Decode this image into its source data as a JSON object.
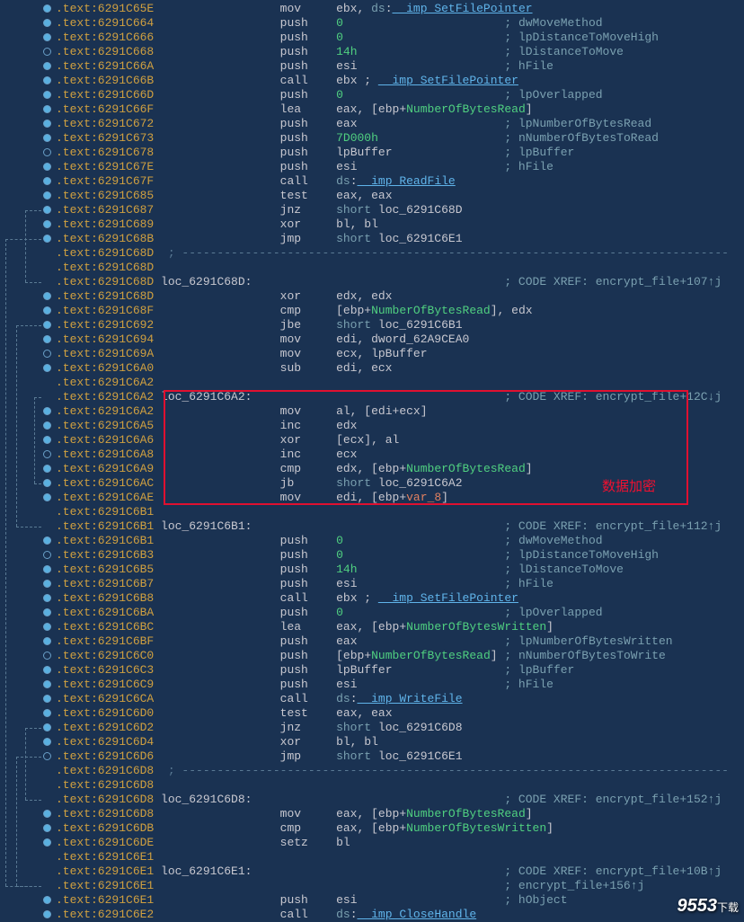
{
  "redbox_label": "数据加密",
  "watermark": {
    "brand": "9553",
    "suffix": "下载"
  },
  "lines": [
    {
      "addr": ".text:6291C65E",
      "mnem": "mov",
      "ops": [
        {
          "t": "reg",
          "v": "ebx, "
        },
        {
          "t": "kw",
          "v": "ds"
        },
        {
          "t": "op",
          "v": ":"
        },
        {
          "t": "imp",
          "v": "__imp_SetFilePointer"
        }
      ]
    },
    {
      "addr": ".text:6291C664",
      "mnem": "push",
      "ops": [
        {
          "t": "num",
          "v": "0"
        }
      ],
      "comment": "dwMoveMethod"
    },
    {
      "addr": ".text:6291C666",
      "mnem": "push",
      "ops": [
        {
          "t": "num",
          "v": "0"
        }
      ],
      "comment": "lpDistanceToMoveHigh"
    },
    {
      "addr": ".text:6291C668",
      "mnem": "push",
      "ops": [
        {
          "t": "num",
          "v": "14h"
        }
      ],
      "comment": "lDistanceToMove"
    },
    {
      "addr": ".text:6291C66A",
      "mnem": "push",
      "ops": [
        {
          "t": "reg",
          "v": "esi"
        }
      ],
      "comment": "hFile"
    },
    {
      "addr": ".text:6291C66B",
      "mnem": "call",
      "ops": [
        {
          "t": "reg",
          "v": "ebx ; "
        },
        {
          "t": "imp",
          "v": "__imp_SetFilePointer"
        }
      ]
    },
    {
      "addr": ".text:6291C66D",
      "mnem": "push",
      "ops": [
        {
          "t": "num",
          "v": "0"
        }
      ],
      "comment": "lpOverlapped"
    },
    {
      "addr": ".text:6291C66F",
      "mnem": "lea",
      "ops": [
        {
          "t": "reg",
          "v": "eax, "
        },
        {
          "t": "op",
          "v": "["
        },
        {
          "t": "reg",
          "v": "ebp"
        },
        {
          "t": "op",
          "v": "+"
        },
        {
          "t": "var",
          "v": "NumberOfBytesRead"
        },
        {
          "t": "op",
          "v": "]"
        }
      ]
    },
    {
      "addr": ".text:6291C672",
      "mnem": "push",
      "ops": [
        {
          "t": "reg",
          "v": "eax"
        }
      ],
      "comment": "lpNumberOfBytesRead"
    },
    {
      "addr": ".text:6291C673",
      "mnem": "push",
      "ops": [
        {
          "t": "num",
          "v": "7D000h"
        }
      ],
      "comment": "nNumberOfBytesToRead"
    },
    {
      "addr": ".text:6291C678",
      "mnem": "push",
      "ops": [
        {
          "t": "reg",
          "v": "lpBuffer"
        }
      ],
      "comment": "lpBuffer"
    },
    {
      "addr": ".text:6291C67E",
      "mnem": "push",
      "ops": [
        {
          "t": "reg",
          "v": "esi"
        }
      ],
      "comment": "hFile"
    },
    {
      "addr": ".text:6291C67F",
      "mnem": "call",
      "ops": [
        {
          "t": "kw",
          "v": "ds"
        },
        {
          "t": "op",
          "v": ":"
        },
        {
          "t": "imp",
          "v": "__imp_ReadFile"
        }
      ]
    },
    {
      "addr": ".text:6291C685",
      "mnem": "test",
      "ops": [
        {
          "t": "reg",
          "v": "eax, eax"
        }
      ]
    },
    {
      "addr": ".text:6291C687",
      "mnem": "jnz",
      "ops": [
        {
          "t": "kw",
          "v": "short "
        },
        {
          "t": "label",
          "v": "loc_6291C68D"
        }
      ]
    },
    {
      "addr": ".text:6291C689",
      "mnem": "xor",
      "ops": [
        {
          "t": "reg",
          "v": "bl, bl"
        }
      ]
    },
    {
      "addr": ".text:6291C68B",
      "mnem": "jmp",
      "ops": [
        {
          "t": "kw",
          "v": "short "
        },
        {
          "t": "label",
          "v": "loc_6291C6E1"
        }
      ]
    },
    {
      "addr": ".text:6291C68D",
      "sep": true
    },
    {
      "addr": ".text:6291C68D",
      "blank": true
    },
    {
      "addr": ".text:6291C68D",
      "labeldef": "loc_6291C68D:",
      "xref": "CODE XREF: encrypt_file+107↑j"
    },
    {
      "addr": ".text:6291C68D",
      "mnem": "xor",
      "ops": [
        {
          "t": "reg",
          "v": "edx, edx"
        }
      ]
    },
    {
      "addr": ".text:6291C68F",
      "mnem": "cmp",
      "ops": [
        {
          "t": "op",
          "v": "["
        },
        {
          "t": "reg",
          "v": "ebp"
        },
        {
          "t": "op",
          "v": "+"
        },
        {
          "t": "var",
          "v": "NumberOfBytesRead"
        },
        {
          "t": "op",
          "v": "], "
        },
        {
          "t": "reg",
          "v": "edx"
        }
      ]
    },
    {
      "addr": ".text:6291C692",
      "mnem": "jbe",
      "ops": [
        {
          "t": "kw",
          "v": "short "
        },
        {
          "t": "label",
          "v": "loc_6291C6B1"
        }
      ]
    },
    {
      "addr": ".text:6291C694",
      "mnem": "mov",
      "ops": [
        {
          "t": "reg",
          "v": "edi, "
        },
        {
          "t": "label",
          "v": "dword_62A9CEA0"
        }
      ]
    },
    {
      "addr": ".text:6291C69A",
      "mnem": "mov",
      "ops": [
        {
          "t": "reg",
          "v": "ecx, lpBuffer"
        }
      ]
    },
    {
      "addr": ".text:6291C6A0",
      "mnem": "sub",
      "ops": [
        {
          "t": "reg",
          "v": "edi, ecx"
        }
      ]
    },
    {
      "addr": ".text:6291C6A2",
      "blank": true
    },
    {
      "addr": ".text:6291C6A2",
      "labeldef": "loc_6291C6A2:",
      "xref": "CODE XREF: encrypt_file+12C↓j"
    },
    {
      "addr": ".text:6291C6A2",
      "mnem": "mov",
      "ops": [
        {
          "t": "reg",
          "v": "al, "
        },
        {
          "t": "op",
          "v": "["
        },
        {
          "t": "reg",
          "v": "edi"
        },
        {
          "t": "op",
          "v": "+"
        },
        {
          "t": "reg",
          "v": "ecx"
        },
        {
          "t": "op",
          "v": "]"
        }
      ]
    },
    {
      "addr": ".text:6291C6A5",
      "mnem": "inc",
      "ops": [
        {
          "t": "reg",
          "v": "edx"
        }
      ]
    },
    {
      "addr": ".text:6291C6A6",
      "mnem": "xor",
      "ops": [
        {
          "t": "op",
          "v": "["
        },
        {
          "t": "reg",
          "v": "ecx"
        },
        {
          "t": "op",
          "v": "], "
        },
        {
          "t": "reg",
          "v": "al"
        }
      ]
    },
    {
      "addr": ".text:6291C6A8",
      "mnem": "inc",
      "ops": [
        {
          "t": "reg",
          "v": "ecx"
        }
      ]
    },
    {
      "addr": ".text:6291C6A9",
      "mnem": "cmp",
      "ops": [
        {
          "t": "reg",
          "v": "edx, "
        },
        {
          "t": "op",
          "v": "["
        },
        {
          "t": "reg",
          "v": "ebp"
        },
        {
          "t": "op",
          "v": "+"
        },
        {
          "t": "var",
          "v": "NumberOfBytesRead"
        },
        {
          "t": "op",
          "v": "]"
        }
      ]
    },
    {
      "addr": ".text:6291C6AC",
      "mnem": "jb",
      "ops": [
        {
          "t": "kw",
          "v": "short "
        },
        {
          "t": "label",
          "v": "loc_6291C6A2"
        }
      ]
    },
    {
      "addr": ".text:6291C6AE",
      "mnem": "mov",
      "ops": [
        {
          "t": "reg",
          "v": "edi, "
        },
        {
          "t": "op",
          "v": "["
        },
        {
          "t": "reg",
          "v": "ebp"
        },
        {
          "t": "op",
          "v": "+"
        },
        {
          "t": "var2",
          "v": "var_8"
        },
        {
          "t": "op",
          "v": "]"
        }
      ]
    },
    {
      "addr": ".text:6291C6B1",
      "blank": true
    },
    {
      "addr": ".text:6291C6B1",
      "labeldef": "loc_6291C6B1:",
      "xref": "CODE XREF: encrypt_file+112↑j"
    },
    {
      "addr": ".text:6291C6B1",
      "mnem": "push",
      "ops": [
        {
          "t": "num",
          "v": "0"
        }
      ],
      "comment": "dwMoveMethod"
    },
    {
      "addr": ".text:6291C6B3",
      "mnem": "push",
      "ops": [
        {
          "t": "num",
          "v": "0"
        }
      ],
      "comment": "lpDistanceToMoveHigh"
    },
    {
      "addr": ".text:6291C6B5",
      "mnem": "push",
      "ops": [
        {
          "t": "num",
          "v": "14h"
        }
      ],
      "comment": "lDistanceToMove"
    },
    {
      "addr": ".text:6291C6B7",
      "mnem": "push",
      "ops": [
        {
          "t": "reg",
          "v": "esi"
        }
      ],
      "comment": "hFile"
    },
    {
      "addr": ".text:6291C6B8",
      "mnem": "call",
      "ops": [
        {
          "t": "reg",
          "v": "ebx ; "
        },
        {
          "t": "imp",
          "v": "__imp_SetFilePointer"
        }
      ]
    },
    {
      "addr": ".text:6291C6BA",
      "mnem": "push",
      "ops": [
        {
          "t": "num",
          "v": "0"
        }
      ],
      "comment": "lpOverlapped"
    },
    {
      "addr": ".text:6291C6BC",
      "mnem": "lea",
      "ops": [
        {
          "t": "reg",
          "v": "eax, "
        },
        {
          "t": "op",
          "v": "["
        },
        {
          "t": "reg",
          "v": "ebp"
        },
        {
          "t": "op",
          "v": "+"
        },
        {
          "t": "var",
          "v": "NumberOfBytesWritten"
        },
        {
          "t": "op",
          "v": "]"
        }
      ]
    },
    {
      "addr": ".text:6291C6BF",
      "mnem": "push",
      "ops": [
        {
          "t": "reg",
          "v": "eax"
        }
      ],
      "comment": "lpNumberOfBytesWritten"
    },
    {
      "addr": ".text:6291C6C0",
      "mnem": "push",
      "ops": [
        {
          "t": "op",
          "v": "["
        },
        {
          "t": "reg",
          "v": "ebp"
        },
        {
          "t": "op",
          "v": "+"
        },
        {
          "t": "var",
          "v": "NumberOfBytesRead"
        },
        {
          "t": "op",
          "v": "]"
        }
      ],
      "comment": "nNumberOfBytesToWrite"
    },
    {
      "addr": ".text:6291C6C3",
      "mnem": "push",
      "ops": [
        {
          "t": "reg",
          "v": "lpBuffer"
        }
      ],
      "comment": "lpBuffer"
    },
    {
      "addr": ".text:6291C6C9",
      "mnem": "push",
      "ops": [
        {
          "t": "reg",
          "v": "esi"
        }
      ],
      "comment": "hFile"
    },
    {
      "addr": ".text:6291C6CA",
      "mnem": "call",
      "ops": [
        {
          "t": "kw",
          "v": "ds"
        },
        {
          "t": "op",
          "v": ":"
        },
        {
          "t": "imp",
          "v": "__imp_WriteFile"
        }
      ]
    },
    {
      "addr": ".text:6291C6D0",
      "mnem": "test",
      "ops": [
        {
          "t": "reg",
          "v": "eax, eax"
        }
      ]
    },
    {
      "addr": ".text:6291C6D2",
      "mnem": "jnz",
      "ops": [
        {
          "t": "kw",
          "v": "short "
        },
        {
          "t": "label",
          "v": "loc_6291C6D8"
        }
      ]
    },
    {
      "addr": ".text:6291C6D4",
      "mnem": "xor",
      "ops": [
        {
          "t": "reg",
          "v": "bl, bl"
        }
      ]
    },
    {
      "addr": ".text:6291C6D6",
      "mnem": "jmp",
      "ops": [
        {
          "t": "kw",
          "v": "short "
        },
        {
          "t": "label",
          "v": "loc_6291C6E1"
        }
      ]
    },
    {
      "addr": ".text:6291C6D8",
      "sep": true
    },
    {
      "addr": ".text:6291C6D8",
      "blank": true
    },
    {
      "addr": ".text:6291C6D8",
      "labeldef": "loc_6291C6D8:",
      "xref": "CODE XREF: encrypt_file+152↑j"
    },
    {
      "addr": ".text:6291C6D8",
      "mnem": "mov",
      "ops": [
        {
          "t": "reg",
          "v": "eax, "
        },
        {
          "t": "op",
          "v": "["
        },
        {
          "t": "reg",
          "v": "ebp"
        },
        {
          "t": "op",
          "v": "+"
        },
        {
          "t": "var",
          "v": "NumberOfBytesRead"
        },
        {
          "t": "op",
          "v": "]"
        }
      ]
    },
    {
      "addr": ".text:6291C6DB",
      "mnem": "cmp",
      "ops": [
        {
          "t": "reg",
          "v": "eax, "
        },
        {
          "t": "op",
          "v": "["
        },
        {
          "t": "reg",
          "v": "ebp"
        },
        {
          "t": "op",
          "v": "+"
        },
        {
          "t": "var",
          "v": "NumberOfBytesWritten"
        },
        {
          "t": "op",
          "v": "]"
        }
      ]
    },
    {
      "addr": ".text:6291C6DE",
      "mnem": "setz",
      "ops": [
        {
          "t": "reg",
          "v": "bl"
        }
      ]
    },
    {
      "addr": ".text:6291C6E1",
      "blank": true
    },
    {
      "addr": ".text:6291C6E1",
      "labeldef": "loc_6291C6E1:",
      "xref": "CODE XREF: encrypt_file+10B↑j"
    },
    {
      "addr": ".text:6291C6E1",
      "xref2": "encrypt_file+156↑j"
    },
    {
      "addr": ".text:6291C6E1",
      "mnem": "push",
      "ops": [
        {
          "t": "reg",
          "v": "esi"
        }
      ],
      "comment": "hObject"
    },
    {
      "addr": ".text:6291C6E2",
      "mnem": "call",
      "ops": [
        {
          "t": "kw",
          "v": "ds"
        },
        {
          "t": "op",
          "v": ":"
        },
        {
          "t": "imp",
          "v": "__imp_CloseHandle"
        }
      ]
    }
  ]
}
